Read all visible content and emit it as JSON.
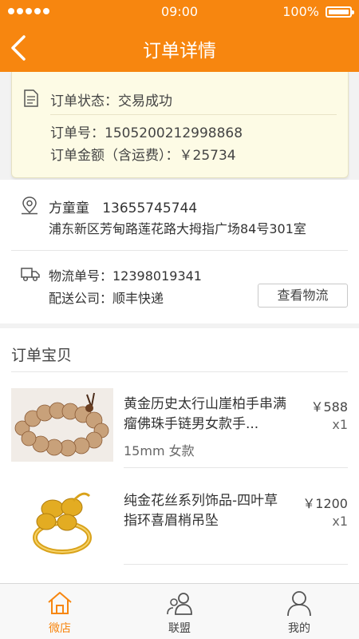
{
  "status_bar": {
    "time": "09:00",
    "battery": "100%",
    "battery_level": 1.0
  },
  "nav": {
    "title": "订单详情",
    "back_icon": "chevron-left-icon"
  },
  "order": {
    "status": "订单状态：交易成功",
    "number": "订单号：1505200212998868",
    "amount": "订单金额（含运费）：￥25734"
  },
  "recipient": {
    "name_phone": "方童童   13655745744",
    "address": "浦东新区芳甸路莲花路大拇指广场84号301室"
  },
  "logistics": {
    "tracking": "物流单号：12398019341",
    "carrier": "配送公司：顺丰快递",
    "track_button": "查看物流"
  },
  "items_section": {
    "title": "订单宝贝",
    "items": [
      {
        "name": "黄金历史太行山崖柏手串满瘤佛珠手链男女款手...",
        "spec": "15mm  女款",
        "price": "￥588",
        "qty": "x1",
        "image": "wooden-bead-bracelet"
      },
      {
        "name": "纯金花丝系列饰品-四叶草指环喜眉梢吊坠",
        "spec": "",
        "price": "￥1200",
        "qty": "x1",
        "image": "gold-clover-ring"
      }
    ]
  },
  "tabbar": {
    "tabs": [
      {
        "label": "微店",
        "icon": "home-icon",
        "active": true
      },
      {
        "label": "联盟",
        "icon": "users-icon",
        "active": false
      },
      {
        "label": "我的",
        "icon": "user-icon",
        "active": false
      }
    ]
  },
  "colors": {
    "accent": "#f7860f",
    "status_card_bg": "#fdfbe5"
  }
}
